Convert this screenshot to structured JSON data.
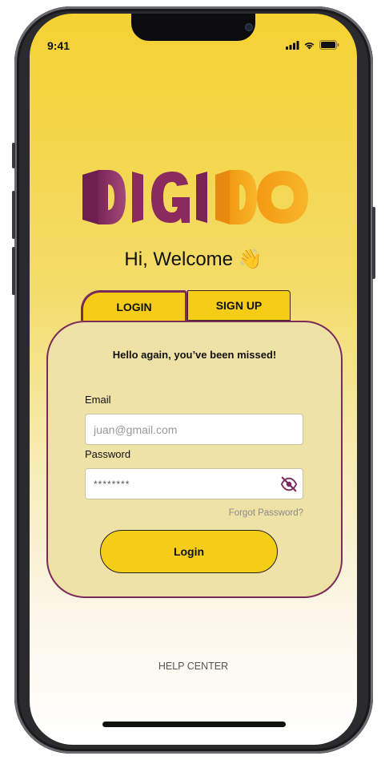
{
  "status_bar": {
    "time": "9:41"
  },
  "brand": {
    "name": "DIGIDO",
    "primary_color": "#8a2a5e",
    "secondary_color": "#f7a81b"
  },
  "greeting": {
    "text": "Hi, Welcome",
    "emoji": "👋"
  },
  "tabs": [
    {
      "label": "LOGIN",
      "active": true
    },
    {
      "label": "SIGN UP",
      "active": false
    }
  ],
  "card": {
    "title": "Hello again, you’ve been missed!",
    "email_label": "Email",
    "email_placeholder": "juan@gmail.com",
    "password_label": "Password",
    "password_value": "********",
    "forgot_password": "Forgot Password?",
    "login_button": "Login"
  },
  "footer": {
    "help_center": "HELP CENTER"
  },
  "icons": [
    "camera-icon",
    "cellular-signal-icon",
    "wifi-icon",
    "battery-icon",
    "eye-slash-icon"
  ]
}
